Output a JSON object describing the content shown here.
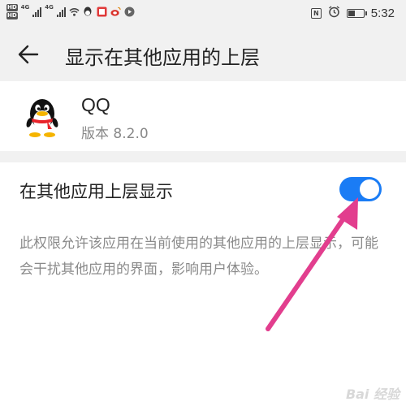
{
  "status_bar": {
    "hd_left": "HD",
    "hd_right": "HD",
    "net1": "4G",
    "net2": "4G",
    "nfc": "N",
    "time": "5:32",
    "battery_level": 0.4,
    "icons": [
      "wifi-icon",
      "qq-notify-icon",
      "app-notify-icon",
      "weibo-icon",
      "media-icon",
      "nfc-icon",
      "alarm-icon",
      "battery-icon"
    ]
  },
  "header": {
    "title": "显示在其他应用的上层"
  },
  "app": {
    "name": "QQ",
    "version": "版本 8.2.0"
  },
  "setting": {
    "label": "在其他应用上层显示",
    "toggle_on": true,
    "description": "此权限允许该应用在当前使用的其他应用的上层显示，可能会干扰其他应用的界面，影响用户体验。"
  },
  "colors": {
    "accent": "#1a7cf5",
    "annotation_arrow": "#e23e8e"
  },
  "watermark": "Bai 经验"
}
